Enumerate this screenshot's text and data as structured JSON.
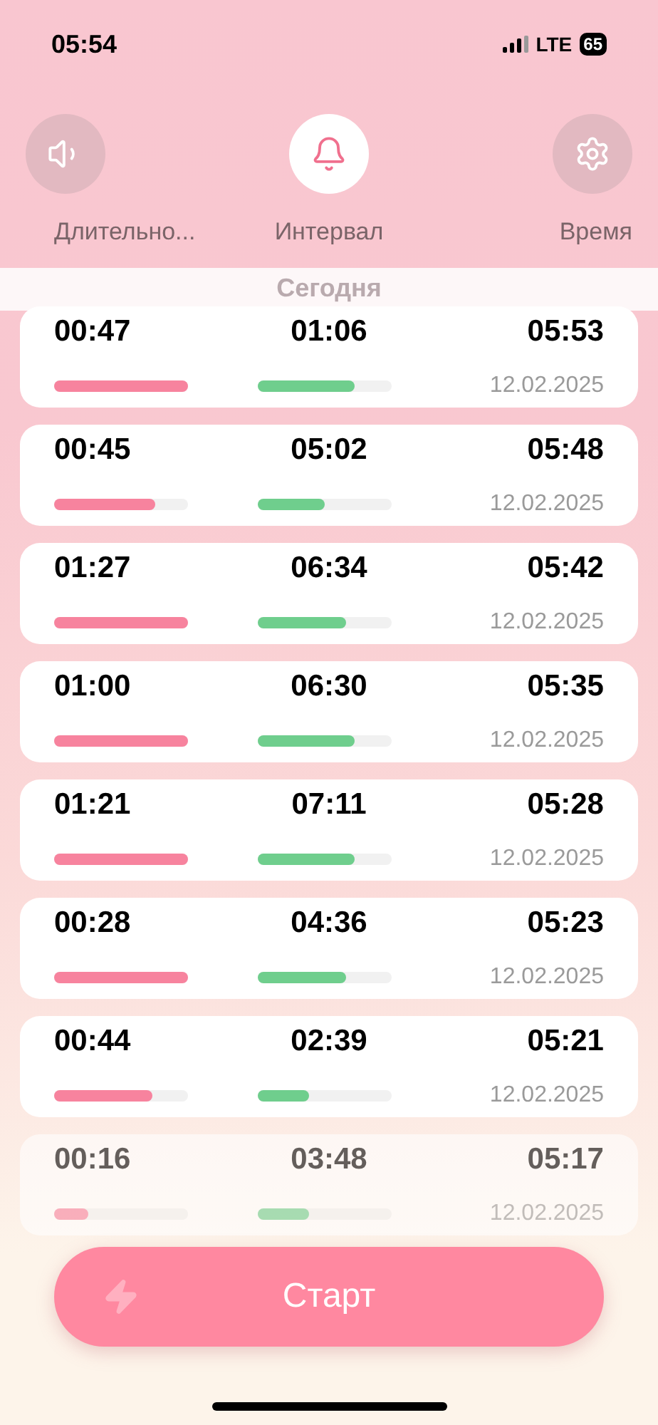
{
  "status_bar": {
    "time": "05:54",
    "network": "LTE",
    "battery": "65"
  },
  "tabs": [
    {
      "label": "Длительно...",
      "selected": false
    },
    {
      "label": "Интервал",
      "selected": true
    },
    {
      "label": "Время",
      "selected": false
    }
  ],
  "section_title": "Сегодня",
  "records": [
    {
      "duration": "00:47",
      "duration_bar": {
        "level": 1
      },
      "interval": "01:06",
      "interval_bar": {
        "level": 0.72
      },
      "time": "05:53",
      "date": "12.02.2025"
    },
    {
      "duration": "00:45",
      "duration_bar": {
        "level": 0.75
      },
      "interval": "05:02",
      "interval_bar": {
        "level": 0.5
      },
      "time": "05:48",
      "date": "12.02.2025"
    },
    {
      "duration": "01:27",
      "duration_bar": {
        "level": 1
      },
      "interval": "06:34",
      "interval_bar": {
        "level": 0.66
      },
      "time": "05:42",
      "date": "12.02.2025"
    },
    {
      "duration": "01:00",
      "duration_bar": {
        "level": 1
      },
      "interval": "06:30",
      "interval_bar": {
        "level": 0.72
      },
      "time": "05:35",
      "date": "12.02.2025"
    },
    {
      "duration": "01:21",
      "duration_bar": {
        "level": 1
      },
      "interval": "07:11",
      "interval_bar": {
        "level": 0.72
      },
      "time": "05:28",
      "date": "12.02.2025"
    },
    {
      "duration": "00:28",
      "duration_bar": {
        "level": 1
      },
      "interval": "04:36",
      "interval_bar": {
        "level": 0.66
      },
      "time": "05:23",
      "date": "12.02.2025"
    },
    {
      "duration": "00:44",
      "duration_bar": {
        "level": 0.73
      },
      "interval": "02:39",
      "interval_bar": {
        "level": 0.38
      },
      "time": "05:21",
      "date": "12.02.2025"
    },
    {
      "duration": "00:16",
      "duration_bar": {
        "level": 0.26
      },
      "interval": "03:48",
      "interval_bar": {
        "level": 0.38
      },
      "time": "05:17",
      "date": "12.02.2025"
    }
  ],
  "start_button": {
    "label": "Старт"
  }
}
